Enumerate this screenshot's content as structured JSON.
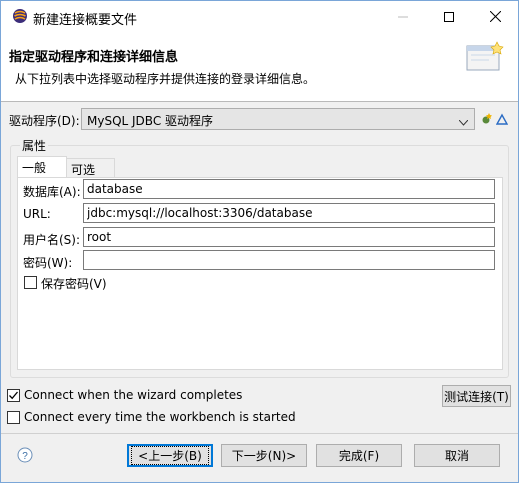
{
  "window": {
    "title": "新建连接概要文件"
  },
  "banner": {
    "title": "指定驱动程序和连接详细信息",
    "description": "从下拉列表中选择驱动程序并提供连接的登录详细信息。"
  },
  "driver": {
    "label": "驱动程序(D):",
    "value": "MySQL JDBC 驱动程序"
  },
  "properties": {
    "group_label": "属性",
    "tabs": [
      {
        "label": "一般(E)"
      },
      {
        "label": "可选(O)"
      }
    ],
    "fields": [
      {
        "label": "数据库(A):",
        "value": "database"
      },
      {
        "label": "URL:",
        "value": "jdbc:mysql://localhost:3306/database"
      },
      {
        "label": "用户名(S):",
        "value": "root"
      },
      {
        "label": "密码(W):",
        "value": ""
      }
    ],
    "save_password_label": "保存密码(V)",
    "save_password_checked": false
  },
  "options": {
    "connect_when_completes": {
      "label": "Connect when the wizard completes",
      "checked": true
    },
    "connect_every_time": {
      "label": "Connect every time the workbench is started",
      "checked": false
    },
    "test_connection_label": "测试连接(T)"
  },
  "footer": {
    "back_label": "<上一步(B)",
    "next_label": "下一步(N)>",
    "finish_label": "完成(F)",
    "cancel_label": "取消"
  },
  "colors": {
    "accent": "#0078d7",
    "title_bar": "#ffffff",
    "dialog_bg": "#f0f0f0"
  },
  "icons": {
    "app": "eclipse-icon",
    "minimize": "minimize-icon",
    "maximize": "maximize-icon",
    "close": "close-icon",
    "banner": "database-wizard-icon",
    "help": "help-icon"
  }
}
